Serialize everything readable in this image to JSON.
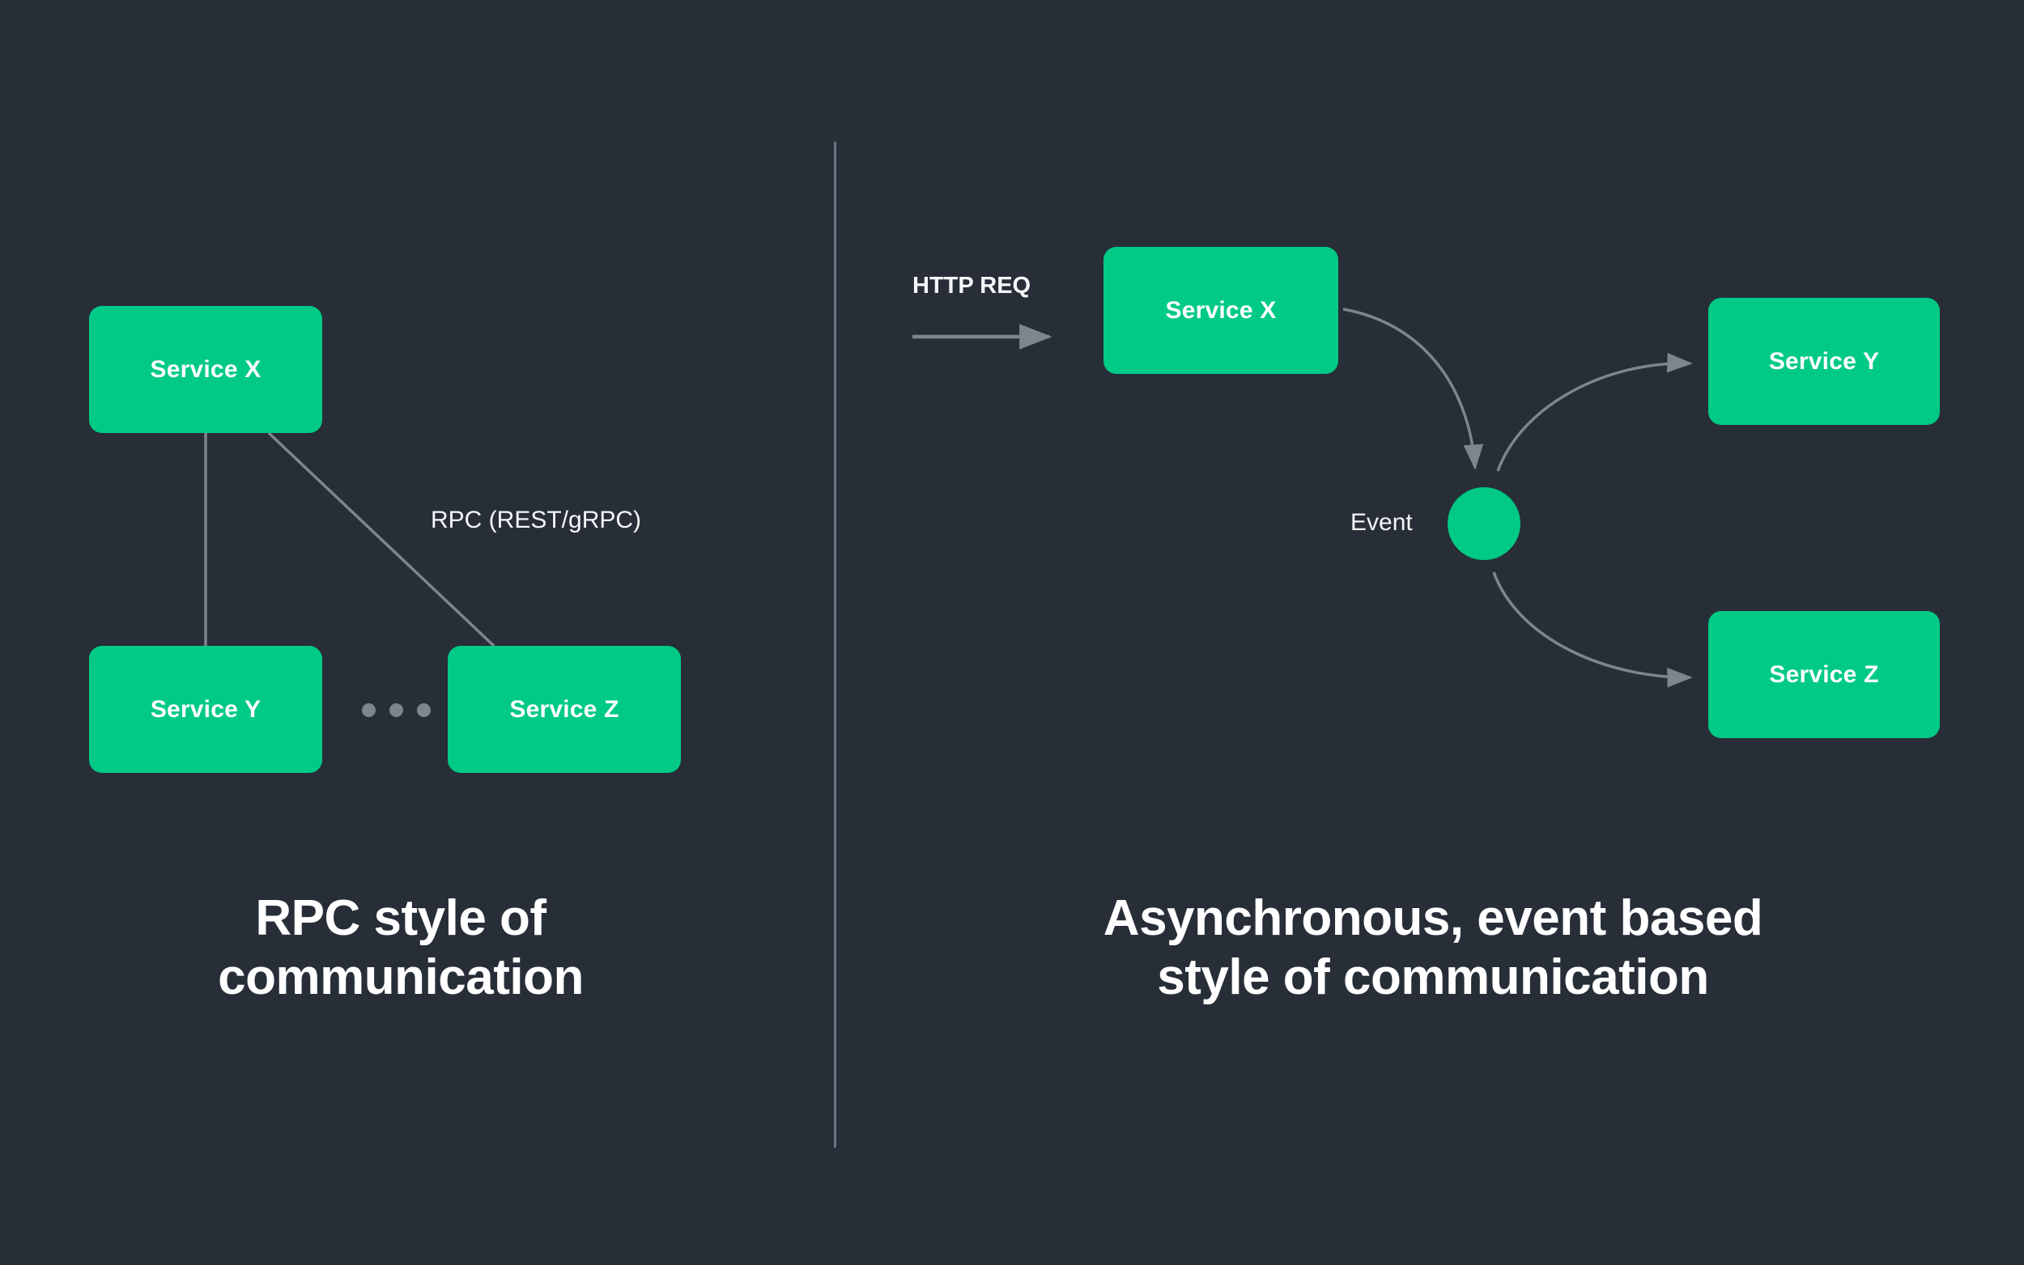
{
  "theme": {
    "background": "#272e38",
    "node_fill": "#00ca86",
    "node_text": "#ffffff",
    "edge_stroke": "#7d858f",
    "caption_text": "#ffffff",
    "divider": "#6b7480"
  },
  "panels": {
    "left": {
      "caption_line1": "RPC style of",
      "caption_line2": "communication",
      "nodes": [
        {
          "id": "rpc-service-x",
          "label": "Service X"
        },
        {
          "id": "rpc-service-y",
          "label": "Service Y"
        },
        {
          "id": "rpc-service-z",
          "label": "Service Z"
        }
      ],
      "edge_labels": [
        {
          "id": "rpc-protocol-label",
          "text": "RPC (REST/gRPC)"
        }
      ],
      "ellipsis": "• • •"
    },
    "right": {
      "caption_line1": "Asynchronous, event based",
      "caption_line2": "style of communication",
      "nodes": [
        {
          "id": "async-service-x",
          "label": "Service X"
        },
        {
          "id": "async-service-y",
          "label": "Service Y"
        },
        {
          "id": "async-service-z",
          "label": "Service Z"
        }
      ],
      "event_node_label": "Event",
      "edge_labels": [
        {
          "id": "http-req-label",
          "text": "HTTP REQ"
        }
      ]
    }
  }
}
